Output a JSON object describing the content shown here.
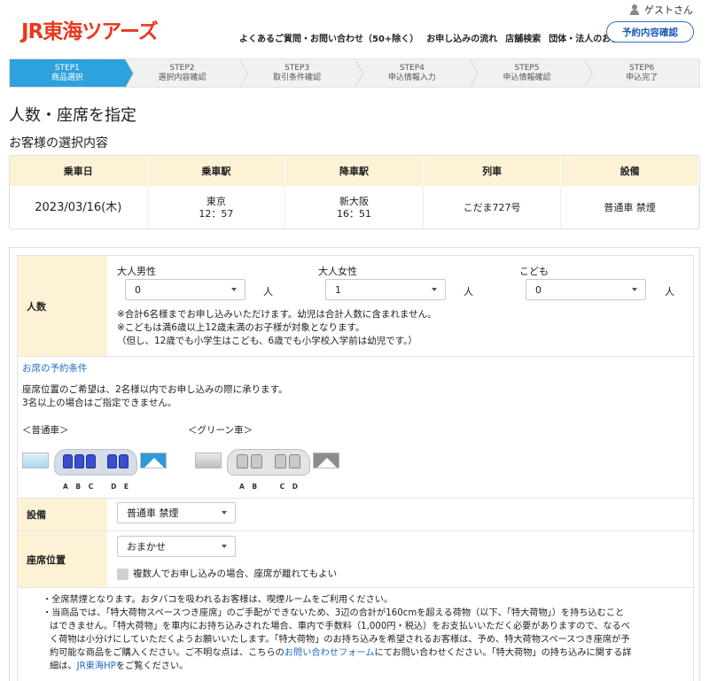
{
  "header": {
    "logo": "JR東海ツアーズ",
    "guest": "ゲストさん",
    "nav": [
      "よくあるご質問・お問い合わせ（50+除く）",
      "お申し込みの流れ",
      "店舗検索",
      "団体・法人のお客様"
    ],
    "confirm_button": "予約内容確認"
  },
  "steps": [
    {
      "num": "STEP1",
      "label": "商品選択"
    },
    {
      "num": "STEP2",
      "label": "選択内容確認"
    },
    {
      "num": "STEP3",
      "label": "取引条件確認"
    },
    {
      "num": "STEP4",
      "label": "申込情報入力"
    },
    {
      "num": "STEP5",
      "label": "申込情報確認"
    },
    {
      "num": "STEP6",
      "label": "申込完了"
    }
  ],
  "page_title": "人数・座席を指定",
  "section_title": "お客様の選択内容",
  "selection": {
    "headers": [
      "乗車日",
      "乗車駅",
      "降車駅",
      "列車",
      "設備"
    ],
    "date": "2023/03/16(木)",
    "board_station": "東京",
    "board_time": "12：57",
    "alight_station": "新大阪",
    "alight_time": "16：51",
    "train": "こだま727号",
    "facility": "普通車 禁煙"
  },
  "form": {
    "people_label": "人数",
    "adult_male": {
      "label": "大人男性",
      "value": "0"
    },
    "adult_female": {
      "label": "大人女性",
      "value": "1"
    },
    "child": {
      "label": "こども",
      "value": "0"
    },
    "unit": "人",
    "notes": [
      "※合計6名様までお申し込みいただけます。幼児は合計人数に含まれません。",
      "※こどもは満6歳以上12歳未満のお子様が対象となります。",
      "（但し、12歳でも小学生はこども、6歳でも小学校入学前は幼児です。）"
    ],
    "seat_conditions_link": "お席の予約条件",
    "seat_conditions": [
      "座席位置のご希望は、2名様以内でお申し込みの際に承ります。",
      "3名以上の場合はご指定できません。"
    ],
    "ordinary_car": "＜普通車＞",
    "green_car": "＜グリーン車＞",
    "ordinary_letters": "A B C   D E",
    "green_letters": "A B    C D",
    "facility_label": "設備",
    "facility_value": "普通車 禁煙",
    "seat_label": "座席位置",
    "seat_value": "おまかせ",
    "separate_ok": "複数人でお申し込みの場合、座席が離れてもよい",
    "bullets": [
      "・全席禁煙となります。おタバコを吸われるお客様は、喫煙ルームをご利用ください。",
      "・当商品では、「特大荷物スペースつき座席」のご手配ができないため、3辺の合計が160cmを超える荷物（以下、「特大荷物」）を持ち込むこと",
      "はできません。「特大荷物」を車内にお持ち込みされた場合、車内で手数料（1,000円・税込）をお支払いいただく必要がありますので、なるべ",
      "く荷物は小分けにしていただくようお願いいたします。「特大荷物」のお持ち込みを希望されるお客様は、予め、特大荷物スペースつき座席が予",
      "約可能な商品をご購入ください。ご不明な点は、こちらの",
      "お問い合わせフォーム",
      "にてお問い合わせください。「特大荷物」の持ち込みに関する詳",
      "細は、",
      "JR東海HP",
      "をご覧ください。"
    ]
  },
  "colors": {
    "brand": "#e8381d",
    "step_active": "#2da2dc",
    "label_bg": "#fdf2d6",
    "link": "#1e6bc4"
  }
}
